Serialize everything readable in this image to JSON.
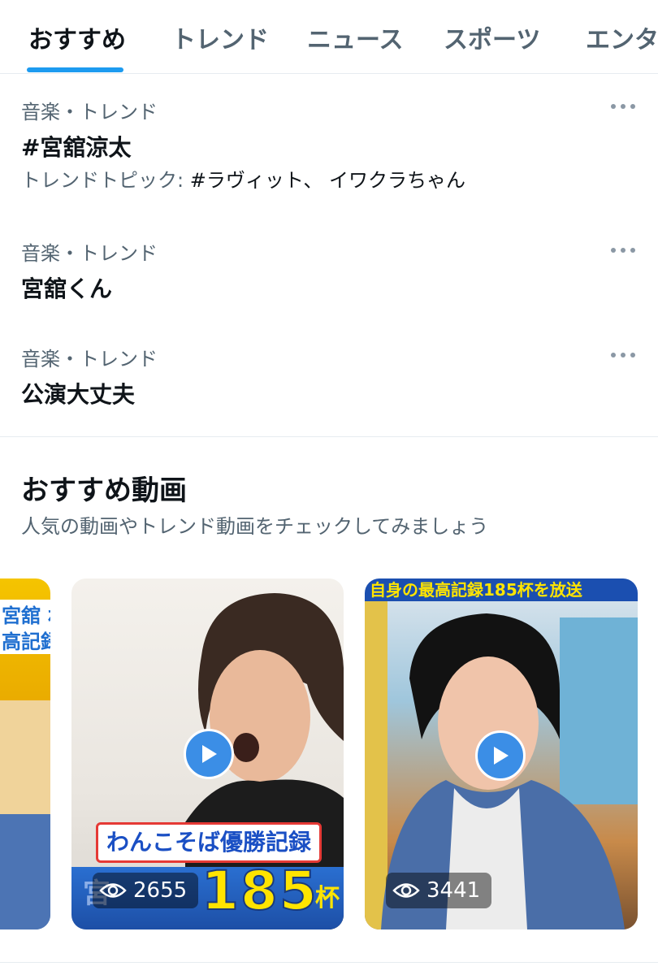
{
  "tabs": [
    {
      "label": "おすすめ",
      "active": true
    },
    {
      "label": "トレンド",
      "active": false
    },
    {
      "label": "ニュース",
      "active": false
    },
    {
      "label": "スポーツ",
      "active": false
    },
    {
      "label": "エンタ",
      "active": false
    }
  ],
  "trends": [
    {
      "meta": "音楽・トレンド",
      "title": "#宮舘涼太",
      "sub_prefix": "トレンドトピック: ",
      "sub_topics": "#ラヴィット、 イワクラちゃん",
      "menu_icon": "more-icon"
    },
    {
      "meta": "音楽・トレンド",
      "title": "宮舘くん",
      "menu_icon": "more-icon"
    },
    {
      "meta": "音楽・トレンド",
      "title": "公演大丈夫",
      "menu_icon": "more-icon"
    }
  ],
  "videos_section": {
    "title": "おすすめ動画",
    "subtitle": "人気の動画やトレンド動画をチェックしてみましょう"
  },
  "videos": [
    {
      "banner_top": "宮舘 わ",
      "banner_mid": "高記録",
      "views": ""
    },
    {
      "caption": "わんこそば優勝記録",
      "big_number": "185",
      "unit": "杯",
      "views": "2655",
      "overlay_text": "宮"
    },
    {
      "banner_top": "自身の最高記録185杯を放送",
      "views": "3441"
    }
  ],
  "colors": {
    "accent": "#1d9bf0",
    "secondary_text": "#536471",
    "play_button": "#3b8ee6"
  }
}
